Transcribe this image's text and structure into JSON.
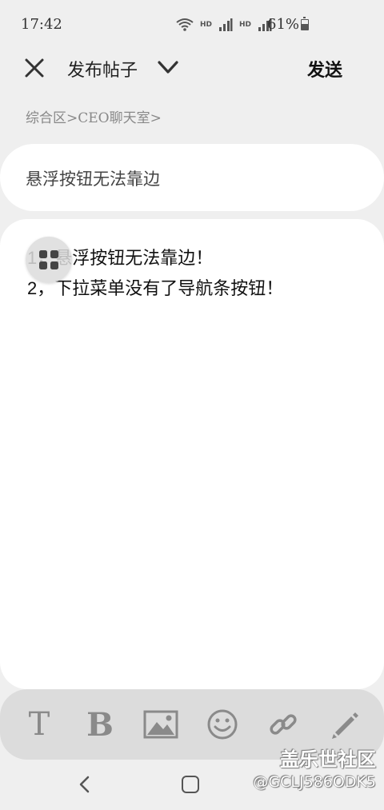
{
  "status_bar": {
    "time": "17:42",
    "battery_text": "61%",
    "network_labels": [
      "HD",
      "4G",
      "HD",
      "4G"
    ]
  },
  "header": {
    "title": "发布帖子",
    "send_label": "发送",
    "close_icon": "close-icon",
    "dropdown_icon": "chevron-down-icon"
  },
  "breadcrumb": "综合区>CEO聊天室>",
  "post": {
    "title": "悬浮按钮无法靠边",
    "body_lines": [
      "1，悬浮按钮无法靠边！",
      "2，下拉菜单没有了导航条按钮！"
    ]
  },
  "toolbar": {
    "text_label": "T",
    "bold_label": "B",
    "icons": [
      "text-icon",
      "bold-icon",
      "image-icon",
      "emoji-icon",
      "link-icon",
      "pencil-icon"
    ]
  },
  "watermark": {
    "brand": "盖乐世社区",
    "user": "@GCLJ586ODK5"
  },
  "colors": {
    "background": "#efefef",
    "card": "#ffffff",
    "toolbar": "#dcdcdc",
    "icon_gray": "#8a8a8a"
  }
}
